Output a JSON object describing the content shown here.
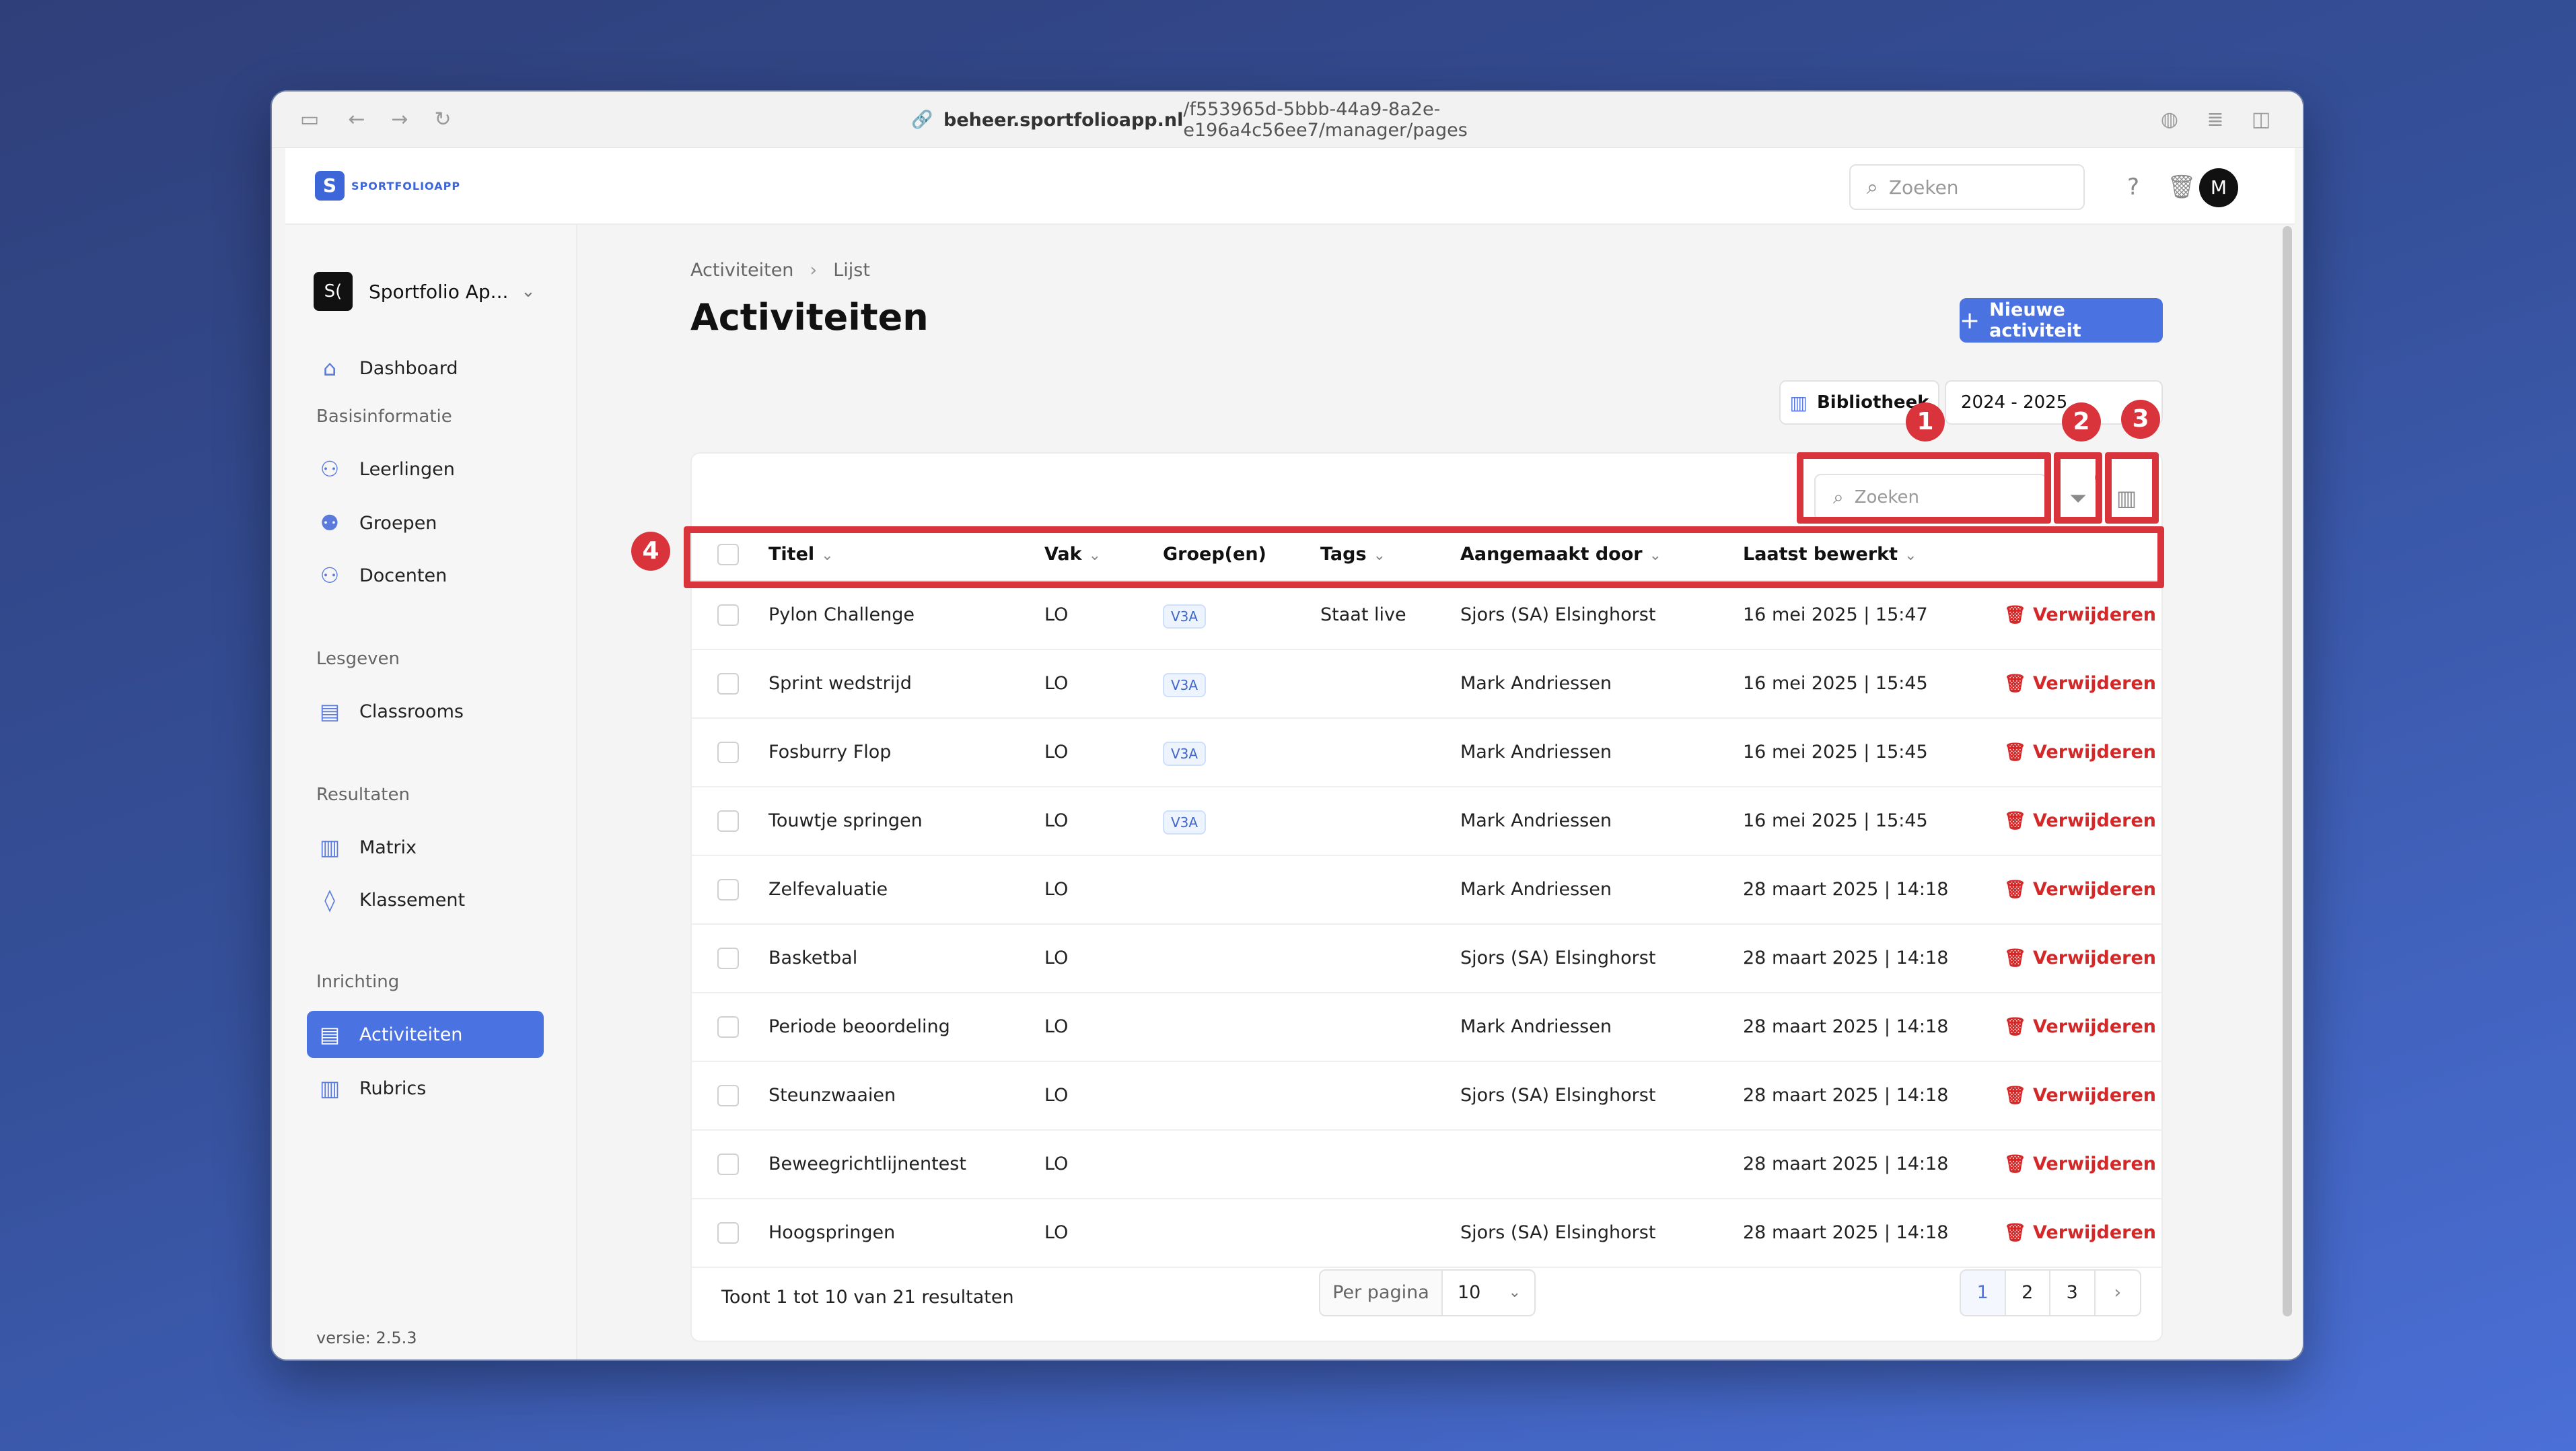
{
  "browser": {
    "url_host": "beheer.sportfolioapp.nl",
    "url_path": "/f553965d-5bbb-44a9-8a2e-e196a4c56ee7/manager/pages"
  },
  "header": {
    "logo_text": "SPORTFOLIOAPP",
    "search_placeholder": "Zoeken",
    "avatar_initial": "M"
  },
  "sidebar": {
    "org_initials": "S(",
    "org_name": "Sportfolio Ap...",
    "dashboard": "Dashboard",
    "sections": {
      "basis": "Basisinformatie",
      "lesgeven": "Lesgeven",
      "resultaten": "Resultaten",
      "inrichting": "Inrichting"
    },
    "items": {
      "leerlingen": "Leerlingen",
      "groepen": "Groepen",
      "docenten": "Docenten",
      "classrooms": "Classrooms",
      "matrix": "Matrix",
      "klassement": "Klassement",
      "activiteiten": "Activiteiten",
      "rubrics": "Rubrics"
    },
    "version": "versie: 2.5.3"
  },
  "page": {
    "breadcrumb_root": "Activiteiten",
    "breadcrumb_current": "Lijst",
    "title": "Activiteiten",
    "new_button": "Nieuwe activiteit",
    "library_button": "Bibliotheek",
    "year_select": "2024 - 2025"
  },
  "table": {
    "search_placeholder": "Zoeken",
    "filter_count": "0",
    "columns": {
      "titel": "Titel",
      "vak": "Vak",
      "groepen": "Groep(en)",
      "tags": "Tags",
      "aangemaakt": "Aangemaakt door",
      "bewerkt": "Laatst bewerkt"
    },
    "delete_label": "Verwijderen",
    "rows": [
      {
        "titel": "Pylon Challenge",
        "vak": "LO",
        "groep": "V3A",
        "tags": "Staat live",
        "door": "Sjors (SA) Elsinghorst",
        "bewerkt": "16 mei 2025 | 15:47"
      },
      {
        "titel": "Sprint wedstrijd",
        "vak": "LO",
        "groep": "V3A",
        "tags": "",
        "door": "Mark Andriessen",
        "bewerkt": "16 mei 2025 | 15:45"
      },
      {
        "titel": "Fosburry Flop",
        "vak": "LO",
        "groep": "V3A",
        "tags": "",
        "door": "Mark Andriessen",
        "bewerkt": "16 mei 2025 | 15:45"
      },
      {
        "titel": "Touwtje springen",
        "vak": "LO",
        "groep": "V3A",
        "tags": "",
        "door": "Mark Andriessen",
        "bewerkt": "16 mei 2025 | 15:45"
      },
      {
        "titel": "Zelfevaluatie",
        "vak": "LO",
        "groep": "",
        "tags": "",
        "door": "Mark Andriessen",
        "bewerkt": "28 maart 2025 | 14:18"
      },
      {
        "titel": "Basketbal",
        "vak": "LO",
        "groep": "",
        "tags": "",
        "door": "Sjors (SA) Elsinghorst",
        "bewerkt": "28 maart 2025 | 14:18"
      },
      {
        "titel": "Periode beoordeling",
        "vak": "LO",
        "groep": "",
        "tags": "",
        "door": "Mark Andriessen",
        "bewerkt": "28 maart 2025 | 14:18"
      },
      {
        "titel": "Steunzwaaien",
        "vak": "LO",
        "groep": "",
        "tags": "",
        "door": "Sjors (SA) Elsinghorst",
        "bewerkt": "28 maart 2025 | 14:18"
      },
      {
        "titel": "Beweegrichtlijnentest",
        "vak": "LO",
        "groep": "",
        "tags": "",
        "door": "",
        "bewerkt": "28 maart 2025 | 14:18"
      },
      {
        "titel": "Hoogspringen",
        "vak": "LO",
        "groep": "",
        "tags": "",
        "door": "Sjors (SA) Elsinghorst",
        "bewerkt": "28 maart 2025 | 14:18"
      }
    ],
    "footer_text": "Toont 1 tot 10 van 21 resultaten",
    "per_page_label": "Per pagina",
    "per_page_value": "10",
    "pages": [
      "1",
      "2",
      "3"
    ],
    "next_glyph": "›"
  },
  "annotations": {
    "m1": "1",
    "m2": "2",
    "m3": "3",
    "m4": "4",
    "color": "#d9343c"
  },
  "colors": {
    "accent": "#4a72e0",
    "danger": "#d42828"
  }
}
